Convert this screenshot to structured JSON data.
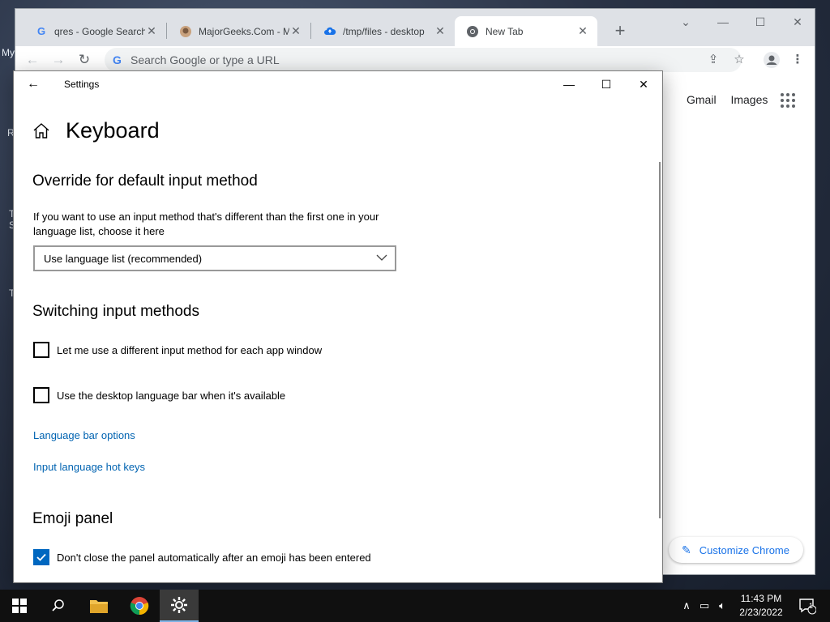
{
  "desktop": {
    "fragments": [
      "My",
      "R",
      "T",
      "S",
      "T"
    ]
  },
  "chrome": {
    "tabs": [
      {
        "title": "qres - Google Search",
        "icon": "google-g-icon"
      },
      {
        "title": "MajorGeeks.Com - M",
        "icon": "majorgeeks-icon"
      },
      {
        "title": "/tmp/files - desktop",
        "icon": "cloud-icon"
      },
      {
        "title": "New Tab",
        "icon": "chrome-icon",
        "active": true
      }
    ],
    "omnibox_placeholder": "Search Google or type a URL",
    "ntp": {
      "gmail": "Gmail",
      "images": "Images",
      "customize": "Customize Chrome"
    }
  },
  "settings": {
    "window_title": "Settings",
    "page_title": "Keyboard",
    "override": {
      "heading": "Override for default input method",
      "description": "If you want to use an input method that's different than the first one in your language list, choose it here",
      "selected_option": "Use language list (recommended)"
    },
    "switching": {
      "heading": "Switching input methods",
      "options": [
        {
          "label": "Let me use a different input method for each app window",
          "checked": false
        },
        {
          "label": "Use the desktop language bar when it's available",
          "checked": false
        }
      ],
      "links": [
        "Language bar options",
        "Input language hot keys"
      ]
    },
    "emoji": {
      "heading": "Emoji panel",
      "option": {
        "label": "Don't close the panel automatically after an emoji has been entered",
        "checked": true
      }
    }
  },
  "taskbar": {
    "time": "11:43 PM",
    "date": "2/23/2022",
    "notification_count": "1",
    "accent": "#0067c0"
  }
}
